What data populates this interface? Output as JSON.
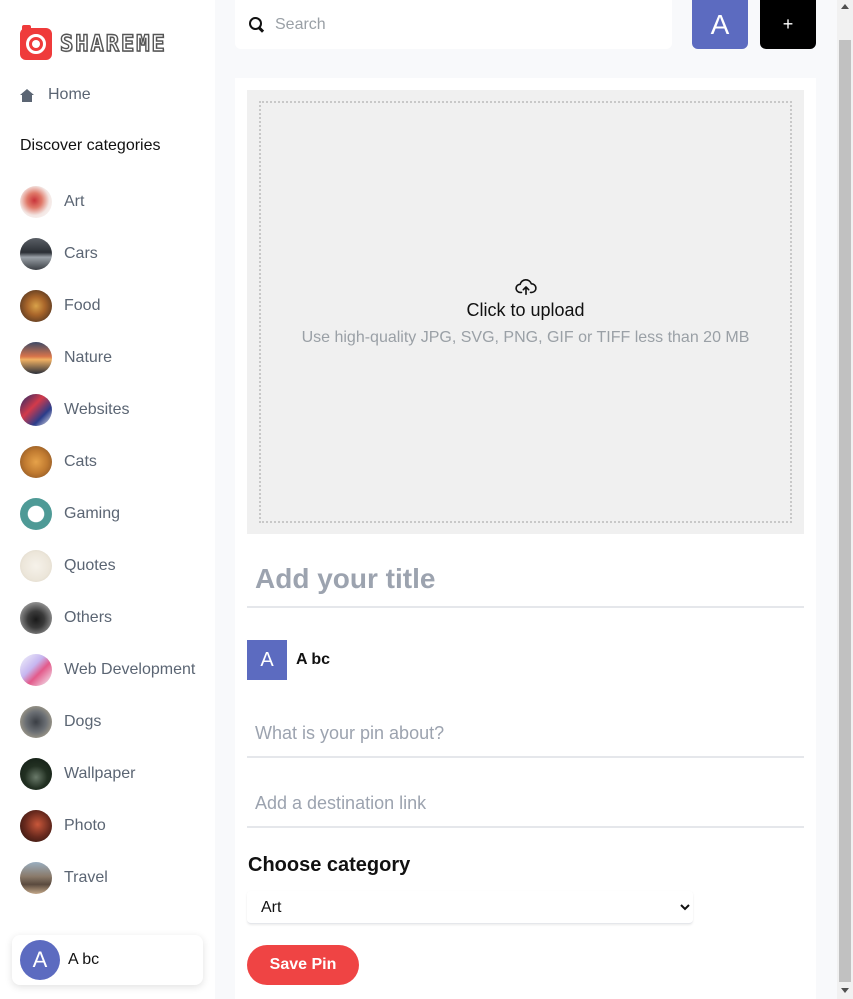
{
  "app": {
    "logo_text": "SHAREME"
  },
  "sidebar": {
    "home_label": "Home",
    "discover_heading": "Discover categories",
    "categories": [
      {
        "label": "Art",
        "thumb": "radial-gradient(circle at 45% 45%, #c9343a 0%, #e07a6a 30%, #f3e6e3 60%, #ffffff 100%)"
      },
      {
        "label": "Cars",
        "thumb": "linear-gradient(180deg, #5a5f66 0%, #2b2f35 45%, #9aa1a8 60%, #3b3f44 100%)"
      },
      {
        "label": "Food",
        "thumb": "radial-gradient(circle at 50% 50%, #d9a24a 0%, #a8652a 40%, #5b3a22 80%)"
      },
      {
        "label": "Nature",
        "thumb": "linear-gradient(180deg, #3d4a66 0%, #d8744a 45%, #f0b062 55%, #2a2f3a 100%)"
      },
      {
        "label": "Websites",
        "thumb": "linear-gradient(135deg, #1c2a6b 0%, #d33a4a 40%, #2a3c8a 70%, #f2f2f2 100%)"
      },
      {
        "label": "Cats",
        "thumb": "radial-gradient(circle at 50% 50%, #e6a24a 0%, #c07a30 50%, #7a4a22 100%)"
      },
      {
        "label": "Gaming",
        "thumb": "radial-gradient(circle at 50% 50%, #ffffff 0%, #ffffff 35%, #4e9a96 38%, #4e9a96 100%)"
      },
      {
        "label": "Quotes",
        "thumb": "radial-gradient(circle at 50% 50%, #f6f2ea 0%, #ece6da 60%, #d8d0c0 100%)"
      },
      {
        "label": "Others",
        "thumb": "radial-gradient(circle at 50% 55%, #1a1a1a 0%, #3a3a3a 35%, #8a8a8a 70%, #c4c4c4 100%)"
      },
      {
        "label": "Web Development",
        "thumb": "linear-gradient(135deg, #f4f6fb 0%, #c6b6f0 40%, #e35a8a 60%, #f4f6fb 100%)"
      },
      {
        "label": "Dogs",
        "thumb": "radial-gradient(circle at 50% 50%, #3a3e44 0%, #6b6f74 45%, #c4b89a 100%)"
      },
      {
        "label": "Wallpaper",
        "thumb": "radial-gradient(circle at 50% 60%, #6a7a6a 0%, #223022 45%, #0f1a12 100%)"
      },
      {
        "label": "Photo",
        "thumb": "radial-gradient(circle at 55% 45%, #c8573a 0%, #6a2a1e 50%, #1e0f0c 100%)"
      },
      {
        "label": "Travel",
        "thumb": "linear-gradient(180deg, #9aaec0 0%, #8a7a6a 45%, #5a4a3e 70%, #c4a88a 100%)"
      }
    ],
    "user": {
      "initial": "A",
      "name": "A bc"
    }
  },
  "topbar": {
    "search_placeholder": "Search",
    "avatar_initial": "A",
    "add_label": "+"
  },
  "form": {
    "upload_title": "Click to upload",
    "upload_hint": "Use high-quality JPG, SVG, PNG, GIF or TIFF less than 20 MB",
    "title_placeholder": "Add your title",
    "author_initial": "A",
    "author_name": "A bc",
    "about_placeholder": "What is your pin about?",
    "link_placeholder": "Add a destination link",
    "category_heading": "Choose category",
    "category_selected": "Art",
    "save_label": "Save Pin"
  },
  "colors": {
    "accent": "#5c6bc0",
    "brand_red": "#ef4444",
    "muted_text": "#5b6573"
  }
}
